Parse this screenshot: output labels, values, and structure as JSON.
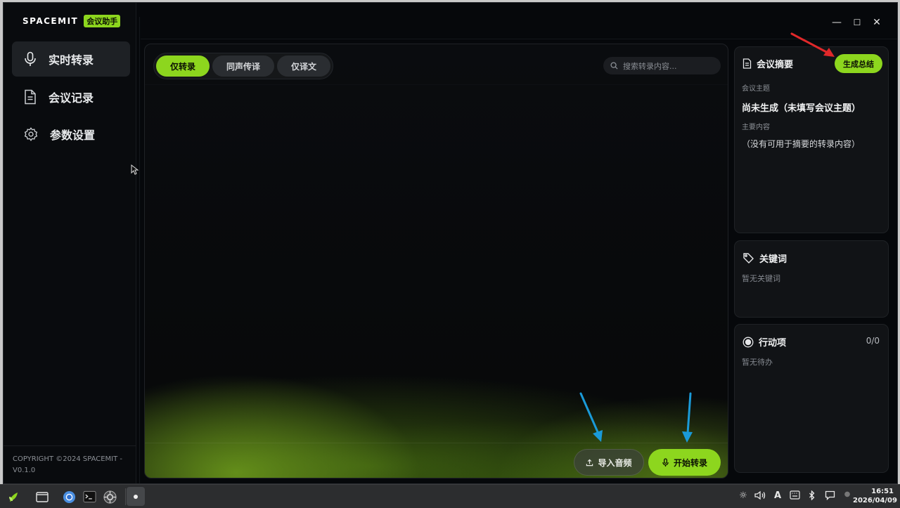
{
  "app": {
    "logo_text": "SPACEMIT",
    "logo_badge": "会议助手"
  },
  "sidebar": {
    "items": [
      {
        "label": "实时转录",
        "icon": "microphone-icon",
        "active": true
      },
      {
        "label": "会议记录",
        "icon": "document-icon",
        "active": false
      },
      {
        "label": "参数设置",
        "icon": "gear-icon",
        "active": false
      }
    ],
    "copyright_line1": "COPYRIGHT ©2024 SPACEMIT -",
    "copyright_line2": "V0.1.0"
  },
  "window_controls": {
    "minimize": "—",
    "maximize": "☐",
    "close": "✕"
  },
  "main": {
    "tabs": [
      {
        "label": "仅转录",
        "active": true
      },
      {
        "label": "同声传译",
        "active": false
      },
      {
        "label": "仅译文",
        "active": false
      }
    ],
    "search_placeholder": "搜索转录内容...",
    "import_button": "导入音频",
    "start_button": "开始转录"
  },
  "summary": {
    "title": "会议摘要",
    "generate_button": "生成总结",
    "topic_label": "会议主题",
    "topic_value": "尚未生成（未填写会议主题）",
    "content_label": "主要内容",
    "content_value": "（没有可用于摘要的转录内容）"
  },
  "keywords": {
    "title": "关键词",
    "empty": "暂无关键词"
  },
  "actions": {
    "title": "行动项",
    "count": "0/0",
    "empty": "暂无待办"
  },
  "taskbar": {
    "time": "16:51",
    "date": "2026/04/09",
    "input_method": "A"
  },
  "colors": {
    "accent": "#8dd61e",
    "annotation_red": "#e0282a",
    "annotation_blue": "#1a9ad8"
  }
}
